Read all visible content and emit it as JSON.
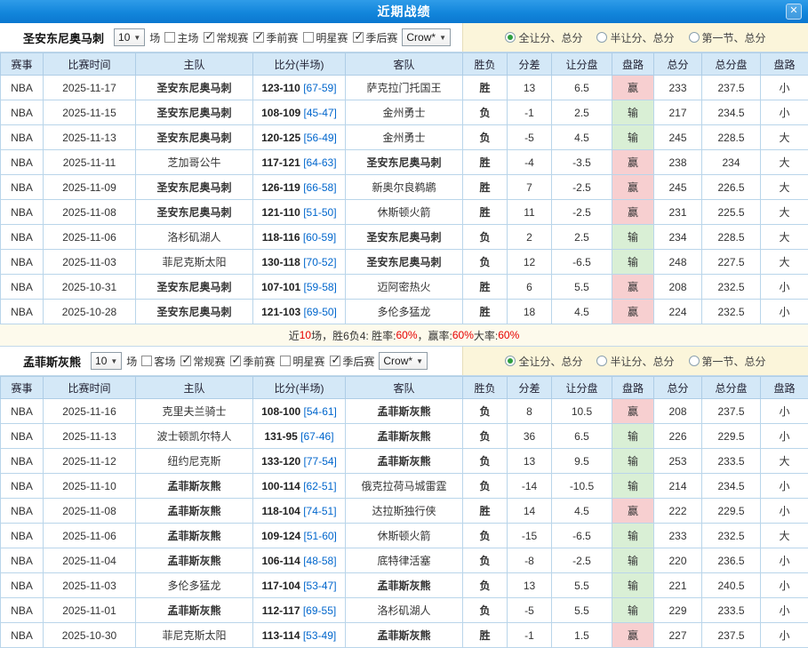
{
  "header": {
    "title": "近期战绩",
    "close_glyph": "✕"
  },
  "sections": [
    {
      "team": "圣安东尼奥马刺",
      "games_select": "10",
      "games_suffix": "场",
      "checkboxes": [
        {
          "name": "home-games",
          "label": "主场",
          "checked": false
        },
        {
          "name": "regular-season",
          "label": "常规赛",
          "checked": true
        },
        {
          "name": "preseason",
          "label": "季前赛",
          "checked": true
        },
        {
          "name": "allstar",
          "label": "明星赛",
          "checked": false
        },
        {
          "name": "playoffs",
          "label": "季后赛",
          "checked": true
        }
      ],
      "company_select": "Crow*",
      "radios": [
        {
          "name": "full-handicap-total",
          "label": "全让分、总分",
          "checked": true
        },
        {
          "name": "half-handicap-total",
          "label": "半让分、总分",
          "checked": false
        },
        {
          "name": "first-quarter-total",
          "label": "第一节、总分",
          "checked": false
        }
      ],
      "columns": [
        "赛事",
        "比赛时间",
        "主队",
        "比分(半场)",
        "客队",
        "胜负",
        "分差",
        "让分盘",
        "盘路",
        "总分",
        "总分盘",
        "盘路"
      ],
      "rows": [
        {
          "league": "NBA",
          "date": "2025-11-17",
          "home": "圣安东尼奥马刺",
          "home_style": "red",
          "score": "123-110",
          "half": "[67-59]",
          "away": "萨克拉门托国王",
          "away_style": "plain",
          "result": "胜",
          "result_style": "win",
          "diff": "13",
          "handicap": "6.5",
          "hcp_result": "赢",
          "hcp_style": "win",
          "total": "233",
          "total_line": "237.5",
          "ou_result": "小",
          "ou_style": "small"
        },
        {
          "league": "NBA",
          "date": "2025-11-15",
          "home": "圣安东尼奥马刺",
          "home_style": "red",
          "score": "108-109",
          "half": "[45-47]",
          "away": "金州勇士",
          "away_style": "plain",
          "result": "负",
          "result_style": "lose",
          "diff": "-1",
          "handicap": "2.5",
          "hcp_result": "输",
          "hcp_style": "lose",
          "total": "217",
          "total_line": "234.5",
          "ou_result": "小",
          "ou_style": "small"
        },
        {
          "league": "NBA",
          "date": "2025-11-13",
          "home": "圣安东尼奥马刺",
          "home_style": "red",
          "score": "120-125",
          "half": "[56-49]",
          "away": "金州勇士",
          "away_style": "plain",
          "result": "负",
          "result_style": "lose",
          "diff": "-5",
          "handicap": "4.5",
          "hcp_result": "输",
          "hcp_style": "lose",
          "total": "245",
          "total_line": "228.5",
          "ou_result": "大",
          "ou_style": "big"
        },
        {
          "league": "NBA",
          "date": "2025-11-11",
          "home": "芝加哥公牛",
          "home_style": "plain",
          "score": "117-121",
          "half": "[64-63]",
          "away": "圣安东尼奥马刺",
          "away_style": "green",
          "result": "胜",
          "result_style": "win",
          "diff": "-4",
          "handicap": "-3.5",
          "hcp_result": "赢",
          "hcp_style": "win",
          "total": "238",
          "total_line": "234",
          "ou_result": "大",
          "ou_style": "big"
        },
        {
          "league": "NBA",
          "date": "2025-11-09",
          "home": "圣安东尼奥马刺",
          "home_style": "red",
          "score": "126-119",
          "half": "[66-58]",
          "away": "新奥尔良鹈鹕",
          "away_style": "plain",
          "result": "胜",
          "result_style": "win",
          "diff": "7",
          "handicap": "-2.5",
          "hcp_result": "赢",
          "hcp_style": "win",
          "total": "245",
          "total_line": "226.5",
          "ou_result": "大",
          "ou_style": "big"
        },
        {
          "league": "NBA",
          "date": "2025-11-08",
          "home": "圣安东尼奥马刺",
          "home_style": "red",
          "score": "121-110",
          "half": "[51-50]",
          "away": "休斯顿火箭",
          "away_style": "plain",
          "result": "胜",
          "result_style": "win",
          "diff": "11",
          "handicap": "-2.5",
          "hcp_result": "赢",
          "hcp_style": "win",
          "total": "231",
          "total_line": "225.5",
          "ou_result": "大",
          "ou_style": "big"
        },
        {
          "league": "NBA",
          "date": "2025-11-06",
          "home": "洛杉矶湖人",
          "home_style": "plain",
          "score": "118-116",
          "half": "[60-59]",
          "away": "圣安东尼奥马刺",
          "away_style": "green",
          "result": "负",
          "result_style": "lose",
          "diff": "2",
          "handicap": "2.5",
          "hcp_result": "输",
          "hcp_style": "lose",
          "total": "234",
          "total_line": "228.5",
          "ou_result": "大",
          "ou_style": "big"
        },
        {
          "league": "NBA",
          "date": "2025-11-03",
          "home": "菲尼克斯太阳",
          "home_style": "plain",
          "score": "130-118",
          "half": "[70-52]",
          "away": "圣安东尼奥马刺",
          "away_style": "green",
          "result": "负",
          "result_style": "lose",
          "diff": "12",
          "handicap": "-6.5",
          "hcp_result": "输",
          "hcp_style": "lose",
          "total": "248",
          "total_line": "227.5",
          "ou_result": "大",
          "ou_style": "big"
        },
        {
          "league": "NBA",
          "date": "2025-10-31",
          "home": "圣安东尼奥马刺",
          "home_style": "red",
          "score": "107-101",
          "half": "[59-58]",
          "away": "迈阿密热火",
          "away_style": "plain",
          "result": "胜",
          "result_style": "win",
          "diff": "6",
          "handicap": "5.5",
          "hcp_result": "赢",
          "hcp_style": "win",
          "total": "208",
          "total_line": "232.5",
          "ou_result": "小",
          "ou_style": "small"
        },
        {
          "league": "NBA",
          "date": "2025-10-28",
          "home": "圣安东尼奥马刺",
          "home_style": "red",
          "score": "121-103",
          "half": "[69-50]",
          "away": "多伦多猛龙",
          "away_style": "plain",
          "result": "胜",
          "result_style": "win",
          "diff": "18",
          "handicap": "4.5",
          "hcp_result": "赢",
          "hcp_style": "win",
          "total": "224",
          "total_line": "232.5",
          "ou_result": "小",
          "ou_style": "small"
        }
      ],
      "summary_parts": [
        {
          "t": "近 ",
          "c": "plain"
        },
        {
          "t": "10",
          "c": "red"
        },
        {
          "t": " 场，胜6负4: 胜率: ",
          "c": "plain"
        },
        {
          "t": "60%",
          "c": "red"
        },
        {
          "t": "，赢率: ",
          "c": "plain"
        },
        {
          "t": "60%",
          "c": "red"
        },
        {
          "t": " 大率: ",
          "c": "plain"
        },
        {
          "t": "60%",
          "c": "red"
        }
      ]
    },
    {
      "team": "孟菲斯灰熊",
      "games_select": "10",
      "games_suffix": "场",
      "checkboxes": [
        {
          "name": "away-games",
          "label": "客场",
          "checked": false
        },
        {
          "name": "regular-season",
          "label": "常规赛",
          "checked": true
        },
        {
          "name": "preseason",
          "label": "季前赛",
          "checked": true
        },
        {
          "name": "allstar",
          "label": "明星赛",
          "checked": false
        },
        {
          "name": "playoffs",
          "label": "季后赛",
          "checked": true
        }
      ],
      "company_select": "Crow*",
      "radios": [
        {
          "name": "full-handicap-total",
          "label": "全让分、总分",
          "checked": true
        },
        {
          "name": "half-handicap-total",
          "label": "半让分、总分",
          "checked": false
        },
        {
          "name": "first-quarter-total",
          "label": "第一节、总分",
          "checked": false
        }
      ],
      "columns": [
        "赛事",
        "比赛时间",
        "主队",
        "比分(半场)",
        "客队",
        "胜负",
        "分差",
        "让分盘",
        "盘路",
        "总分",
        "总分盘",
        "盘路"
      ],
      "rows": [
        {
          "league": "NBA",
          "date": "2025-11-16",
          "home": "克里夫兰骑士",
          "home_style": "plain",
          "score": "108-100",
          "half": "[54-61]",
          "away": "孟菲斯灰熊",
          "away_style": "green",
          "result": "负",
          "result_style": "lose",
          "diff": "8",
          "handicap": "10.5",
          "hcp_result": "赢",
          "hcp_style": "win",
          "total": "208",
          "total_line": "237.5",
          "ou_result": "小",
          "ou_style": "small"
        },
        {
          "league": "NBA",
          "date": "2025-11-13",
          "home": "波士顿凯尔特人",
          "home_style": "plain",
          "score": "131-95",
          "half": "[67-46]",
          "away": "孟菲斯灰熊",
          "away_style": "green",
          "result": "负",
          "result_style": "lose",
          "diff": "36",
          "handicap": "6.5",
          "hcp_result": "输",
          "hcp_style": "lose",
          "total": "226",
          "total_line": "229.5",
          "ou_result": "小",
          "ou_style": "small"
        },
        {
          "league": "NBA",
          "date": "2025-11-12",
          "home": "纽约尼克斯",
          "home_style": "plain",
          "score": "133-120",
          "half": "[77-54]",
          "away": "孟菲斯灰熊",
          "away_style": "green",
          "result": "负",
          "result_style": "lose",
          "diff": "13",
          "handicap": "9.5",
          "hcp_result": "输",
          "hcp_style": "lose",
          "total": "253",
          "total_line": "233.5",
          "ou_result": "大",
          "ou_style": "big"
        },
        {
          "league": "NBA",
          "date": "2025-11-10",
          "home": "孟菲斯灰熊",
          "home_style": "green",
          "score": "100-114",
          "half": "[62-51]",
          "away": "俄克拉荷马城雷霆",
          "away_style": "plain",
          "result": "负",
          "result_style": "lose",
          "diff": "-14",
          "handicap": "-10.5",
          "hcp_result": "输",
          "hcp_style": "lose",
          "total": "214",
          "total_line": "234.5",
          "ou_result": "小",
          "ou_style": "small"
        },
        {
          "league": "NBA",
          "date": "2025-11-08",
          "home": "孟菲斯灰熊",
          "home_style": "green",
          "score": "118-104",
          "half": "[74-51]",
          "away": "达拉斯独行侠",
          "away_style": "plain",
          "result": "胜",
          "result_style": "win",
          "diff": "14",
          "handicap": "4.5",
          "hcp_result": "赢",
          "hcp_style": "win",
          "total": "222",
          "total_line": "229.5",
          "ou_result": "小",
          "ou_style": "small"
        },
        {
          "league": "NBA",
          "date": "2025-11-06",
          "home": "孟菲斯灰熊",
          "home_style": "green",
          "score": "109-124",
          "half": "[51-60]",
          "away": "休斯顿火箭",
          "away_style": "plain",
          "result": "负",
          "result_style": "lose",
          "diff": "-15",
          "handicap": "-6.5",
          "hcp_result": "输",
          "hcp_style": "lose",
          "total": "233",
          "total_line": "232.5",
          "ou_result": "大",
          "ou_style": "big"
        },
        {
          "league": "NBA",
          "date": "2025-11-04",
          "home": "孟菲斯灰熊",
          "home_style": "green",
          "score": "106-114",
          "half": "[48-58]",
          "away": "底特律活塞",
          "away_style": "plain",
          "result": "负",
          "result_style": "lose",
          "diff": "-8",
          "handicap": "-2.5",
          "hcp_result": "输",
          "hcp_style": "lose",
          "total": "220",
          "total_line": "236.5",
          "ou_result": "小",
          "ou_style": "small"
        },
        {
          "league": "NBA",
          "date": "2025-11-03",
          "home": "多伦多猛龙",
          "home_style": "plain",
          "score": "117-104",
          "half": "[53-47]",
          "away": "孟菲斯灰熊",
          "away_style": "green",
          "result": "负",
          "result_style": "lose",
          "diff": "13",
          "handicap": "5.5",
          "hcp_result": "输",
          "hcp_style": "lose",
          "total": "221",
          "total_line": "240.5",
          "ou_result": "小",
          "ou_style": "small"
        },
        {
          "league": "NBA",
          "date": "2025-11-01",
          "home": "孟菲斯灰熊",
          "home_style": "green",
          "score": "112-117",
          "half": "[69-55]",
          "away": "洛杉矶湖人",
          "away_style": "plain",
          "result": "负",
          "result_style": "lose",
          "diff": "-5",
          "handicap": "5.5",
          "hcp_result": "输",
          "hcp_style": "lose",
          "total": "229",
          "total_line": "233.5",
          "ou_result": "小",
          "ou_style": "small"
        },
        {
          "league": "NBA",
          "date": "2025-10-30",
          "home": "菲尼克斯太阳",
          "home_style": "plain",
          "score": "113-114",
          "half": "[53-49]",
          "away": "孟菲斯灰熊",
          "away_style": "green",
          "result": "胜",
          "result_style": "win",
          "diff": "-1",
          "handicap": "1.5",
          "hcp_result": "赢",
          "hcp_style": "win",
          "total": "227",
          "total_line": "237.5",
          "ou_result": "小",
          "ou_style": "small"
        }
      ]
    }
  ]
}
